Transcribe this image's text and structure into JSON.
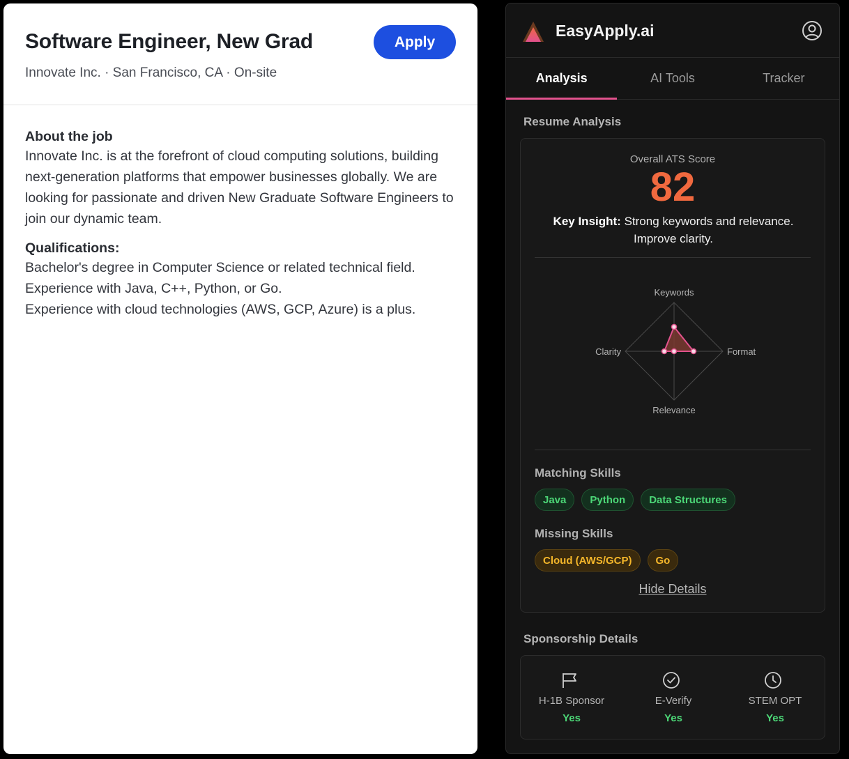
{
  "job": {
    "title": "Software Engineer, New Grad",
    "meta": "Innovate Inc. · San Francisco, CA · On-site",
    "apply_label": "Apply",
    "about_heading": "About the job",
    "about_text": "Innovate Inc. is at the forefront of cloud computing solutions, building next-generation platforms that empower businesses globally. We are looking for passionate and driven New Graduate Software Engineers to join our dynamic team.",
    "qualifications_heading": "Qualifications:",
    "qualifications": [
      "Bachelor's degree in Computer Science or related technical field.",
      "Experience with Java, C++, Python, or Go.",
      "Experience with cloud technologies (AWS, GCP, Azure) is a plus."
    ]
  },
  "panel": {
    "brand": "EasyApply.ai",
    "tabs": [
      {
        "label": "Analysis",
        "active": true
      },
      {
        "label": "AI Tools",
        "active": false
      },
      {
        "label": "Tracker",
        "active": false
      }
    ],
    "resume_section_title": "Resume Analysis",
    "ats": {
      "label": "Overall ATS Score",
      "score": "82",
      "insight_prefix": "Key Insight:",
      "insight_text": "Strong keywords and relevance. Improve clarity."
    },
    "radar": {
      "axes": [
        "Keywords",
        "Format",
        "Relevance",
        "Clarity"
      ],
      "values": [
        0.5,
        0.4,
        0.0,
        0.2
      ],
      "stroke_color": "#e2528d",
      "fill_color": "#7a3a30"
    },
    "matching_title": "Matching Skills",
    "matching_skills": [
      "Java",
      "Python",
      "Data Structures"
    ],
    "missing_title": "Missing Skills",
    "missing_skills": [
      "Cloud (AWS/GCP)",
      "Go"
    ],
    "hide_details": "Hide Details",
    "sponsorship_title": "Sponsorship Details",
    "sponsorship": [
      {
        "label": "H-1B Sponsor",
        "value": "Yes",
        "icon": "flag-icon"
      },
      {
        "label": "E-Verify",
        "value": "Yes",
        "icon": "check-circle-icon"
      },
      {
        "label": "STEM OPT",
        "value": "Yes",
        "icon": "clock-icon"
      }
    ],
    "colors": {
      "accent_pink": "#e2528d",
      "score_orange": "#f0693f",
      "success_green": "#4cd777",
      "warning_amber": "#f4b62a",
      "apply_blue": "#1d4fe0"
    }
  }
}
